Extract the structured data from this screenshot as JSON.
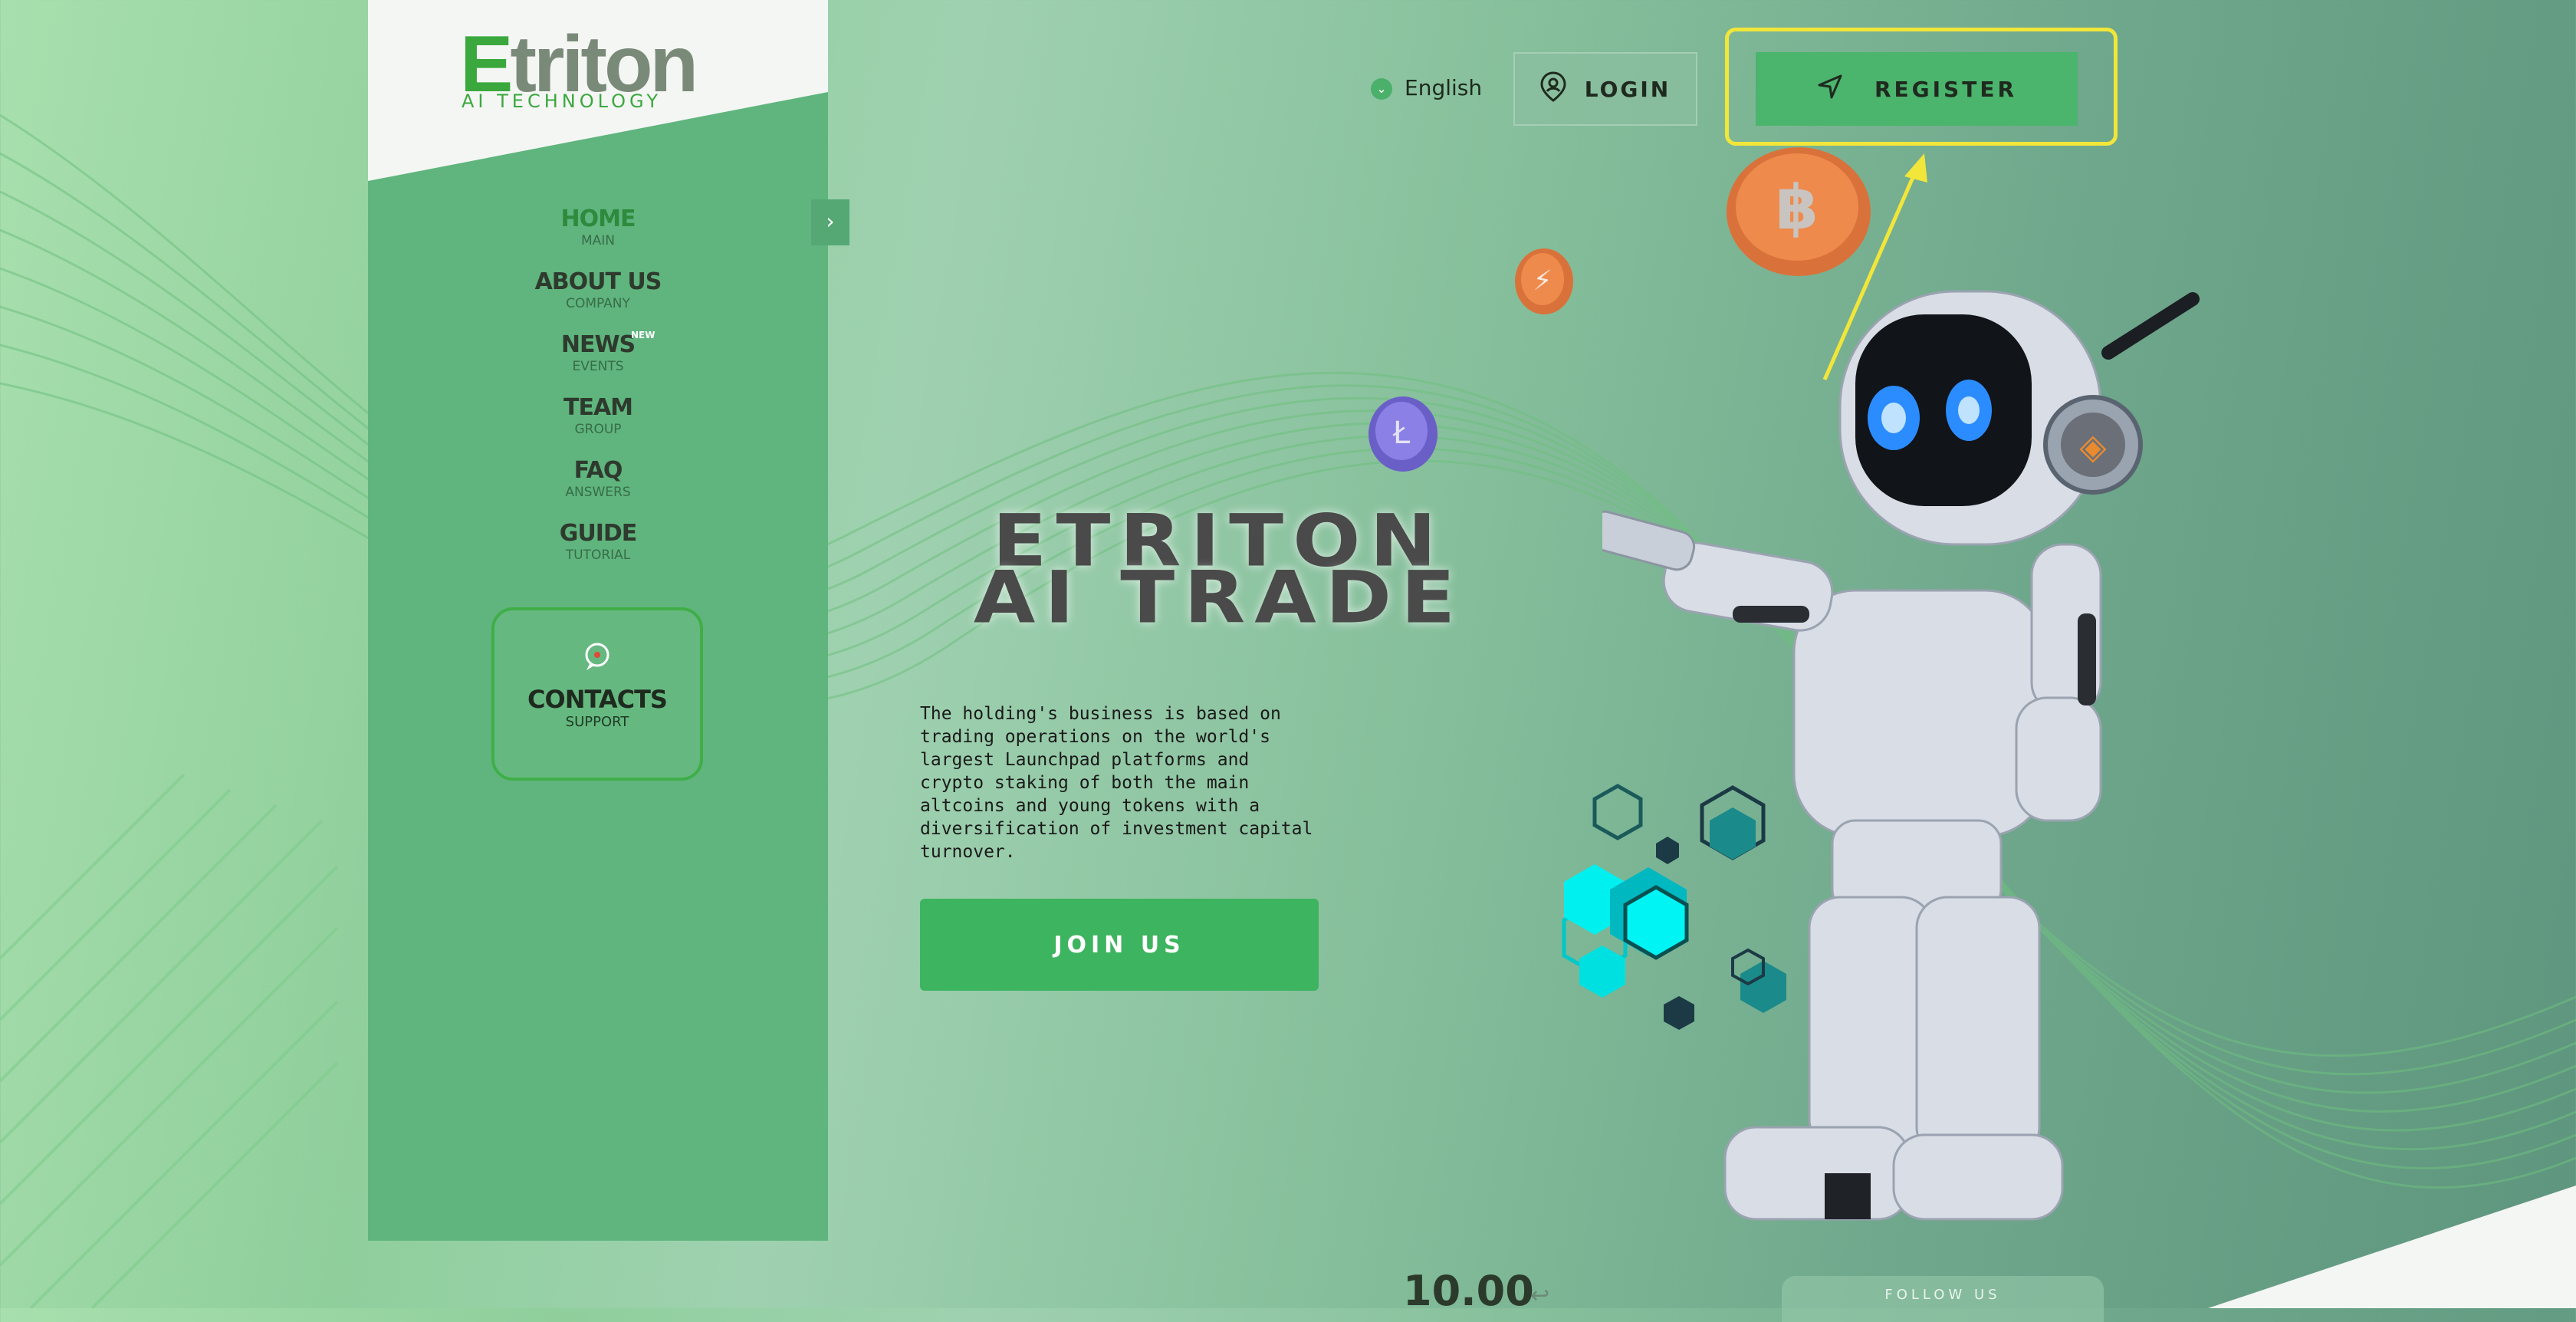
{
  "brand": {
    "logo_first_letter": "E",
    "logo_rest": "triton",
    "tagline": "AI TECHNOLOGY"
  },
  "nav": {
    "collapse_icon": "chevron-right-icon",
    "items": [
      {
        "label": "HOME",
        "sub": "MAIN",
        "active": true
      },
      {
        "label": "ABOUT US",
        "sub": "COMPANY"
      },
      {
        "label": "NEWS",
        "sub": "EVENTS",
        "badge": "NEW"
      },
      {
        "label": "TEAM",
        "sub": "GROUP"
      },
      {
        "label": "FAQ",
        "sub": "ANSWERS"
      },
      {
        "label": "GUIDE",
        "sub": "TUTORIAL"
      }
    ],
    "contacts": {
      "label": "CONTACTS",
      "sub": "SUPPORT",
      "icon": "chat-bubble-icon"
    }
  },
  "header": {
    "language": "English",
    "login_label": "LOGIN",
    "register_label": "REGISTER"
  },
  "hero": {
    "title_line1": "ETRITON",
    "title_line2": "AI TRADE",
    "description": "The holding's business is based on trading operations on the world's largest Launchpad platforms and crypto staking of both the main altcoins and young tokens with a diversification of investment capital turnover.",
    "cta": "JOIN US"
  },
  "footer": {
    "counter": "10.00",
    "follow_label": "FOLLOW US"
  },
  "colors": {
    "brand_green": "#3aa83d",
    "sidebar": "#5fb57d",
    "cta": "#3db45f",
    "highlight": "#f2e63a"
  }
}
